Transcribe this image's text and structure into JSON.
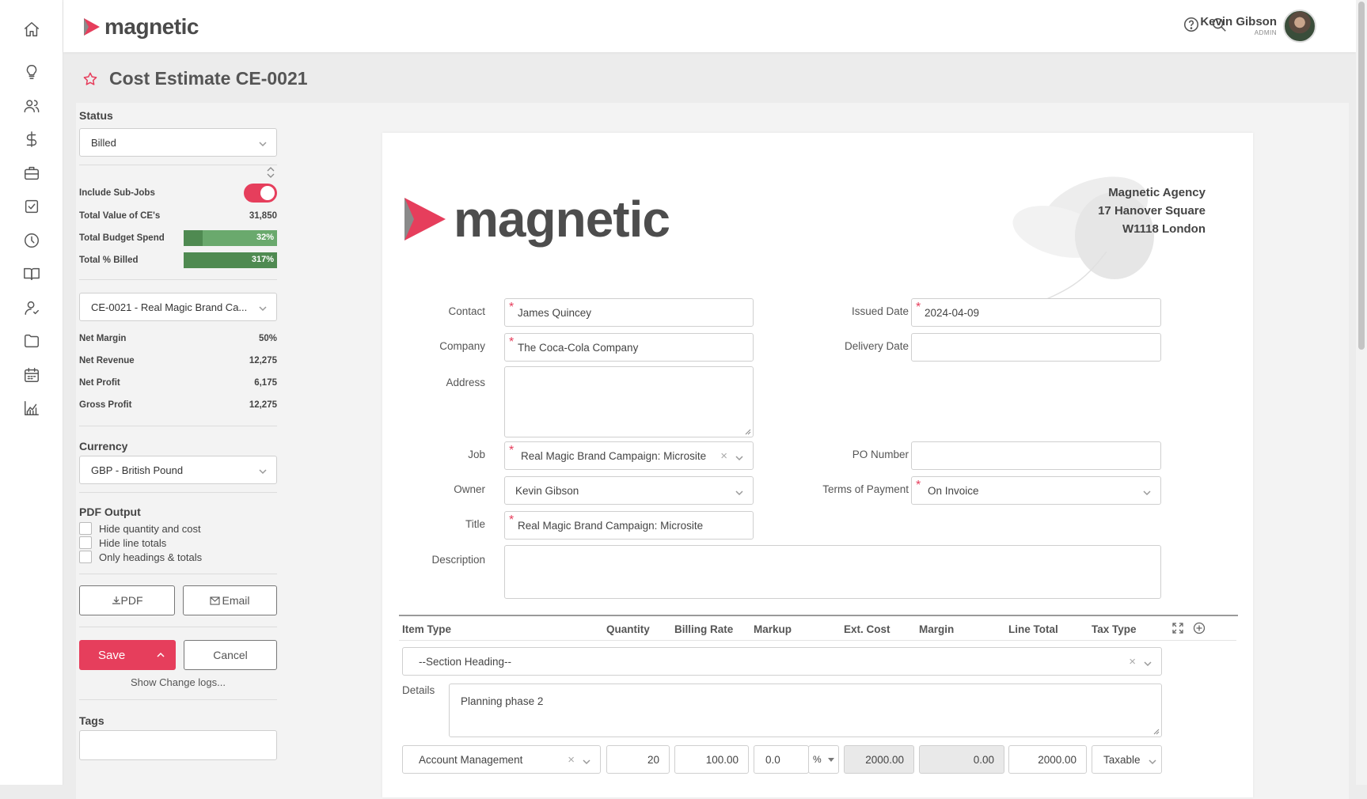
{
  "app": {
    "brand": "magnetic",
    "brand_color": "#e63e5c"
  },
  "rail": {
    "items": [
      "home-icon",
      "lightbulb-icon",
      "people-icon",
      "dollar-icon",
      "briefcase-icon",
      "task-check-icon",
      "clock-icon",
      "book-icon",
      "user-icon",
      "folder-icon",
      "calendar-icon",
      "chart-icon"
    ]
  },
  "header": {
    "user_name": "Kevin Gibson",
    "user_role": "ADMIN"
  },
  "page": {
    "title": "Cost Estimate CE-0021"
  },
  "sidebar": {
    "status_label": "Status",
    "status_value": "Billed",
    "include_subjobs_label": "Include Sub-Jobs",
    "include_subjobs_on": true,
    "total_value_label": "Total Value of CE's",
    "total_value": "31,850",
    "budget_spend_label": "Total Budget Spend",
    "budget_spend": "32%",
    "budget_spend_fill": 0.2,
    "pct_billed_label": "Total % Billed",
    "pct_billed": "317%",
    "estimate_select": "CE-0021 - Real Magic Brand Ca...",
    "net_margin_label": "Net Margin",
    "net_margin": "50%",
    "net_revenue_label": "Net Revenue",
    "net_revenue": "12,275",
    "net_profit_label": "Net Profit",
    "net_profit": "6,175",
    "gross_profit_label": "Gross Profit",
    "gross_profit": "12,275",
    "currency_label": "Currency",
    "currency_value": "GBP - British Pound",
    "pdf_output_label": "PDF Output",
    "pdf_options": [
      "Hide quantity and cost",
      "Hide line totals",
      "Only headings & totals"
    ],
    "pdf_button": "PDF",
    "email_button": "Email",
    "save_button": "Save",
    "cancel_button": "Cancel",
    "change_logs_link": "Show Change logs...",
    "tags_label": "Tags"
  },
  "document": {
    "logo_text": "magnetic",
    "agency_name": "Magnetic Agency",
    "agency_street": "17 Hanover Square",
    "agency_city": "W1118 London",
    "fields": {
      "contact_label": "Contact",
      "contact_value": "James Quincey",
      "company_label": "Company",
      "company_value": "The Coca-Cola Company",
      "address_label": "Address",
      "address_value": "",
      "job_label": "Job",
      "job_value": "Real Magic Brand Campaign: Microsite",
      "owner_label": "Owner",
      "owner_value": "Kevin Gibson",
      "title_label": "Title",
      "title_value": "Real Magic Brand Campaign: Microsite",
      "description_label": "Description",
      "description_value": "",
      "issued_date_label": "Issued Date",
      "issued_date_value": "2024-04-09",
      "delivery_date_label": "Delivery Date",
      "delivery_date_value": "",
      "po_number_label": "PO Number",
      "po_number_value": "",
      "terms_label": "Terms of Payment",
      "terms_value": "On Invoice"
    },
    "table": {
      "headers": [
        "Item Type",
        "Quantity",
        "Billing Rate",
        "Markup",
        "Ext. Cost",
        "Margin",
        "Line Total",
        "Tax Type"
      ],
      "section_heading": "--Section Heading--",
      "details_label": "Details",
      "details_value": "Planning phase 2",
      "line": {
        "item_type": "Account Management",
        "quantity": "20",
        "billing_rate": "100.00",
        "markup": "0.0",
        "markup_unit": "%",
        "ext_cost": "2000.00",
        "margin": "0.00",
        "line_total": "2000.00",
        "tax_type": "Taxable"
      }
    }
  }
}
